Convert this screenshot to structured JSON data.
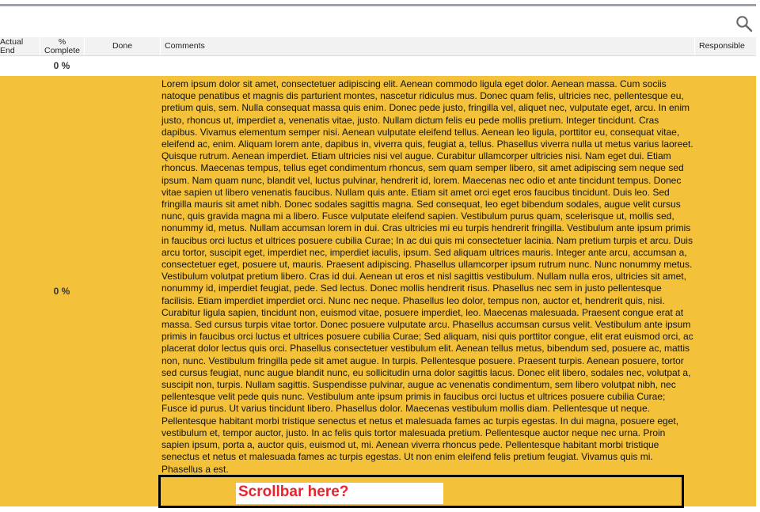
{
  "columns": {
    "actual_end": "Actual\nEnd",
    "pct_complete": "%\nComplete",
    "done": "Done",
    "comments": "Comments",
    "responsible": "Responsible"
  },
  "rows": [
    {
      "pct_complete": "0 %",
      "comment": ""
    },
    {
      "pct_complete": "0 %",
      "comment": "Lorem ipsum dolor sit amet, consectetuer adipiscing elit. Aenean commodo ligula eget dolor. Aenean massa. Cum sociis natoque penatibus et magnis dis parturient montes, nascetur ridiculus mus. Donec quam felis, ultricies nec, pellentesque eu, pretium quis, sem. Nulla consequat massa quis enim. Donec pede justo, fringilla vel, aliquet nec, vulputate eget, arcu. In enim justo, rhoncus ut, imperdiet a, venenatis vitae, justo. Nullam dictum felis eu pede mollis pretium. Integer tincidunt. Cras dapibus. Vivamus elementum semper nisi. Aenean vulputate eleifend tellus. Aenean leo ligula, porttitor eu, consequat vitae, eleifend ac, enim. Aliquam lorem ante, dapibus in, viverra quis, feugiat a, tellus. Phasellus viverra nulla ut metus varius laoreet. Quisque rutrum. Aenean imperdiet. Etiam ultricies nisi vel augue. Curabitur ullamcorper ultricies nisi. Nam eget dui. Etiam rhoncus. Maecenas tempus, tellus eget condimentum rhoncus, sem quam semper libero, sit amet adipiscing sem neque sed ipsum. Nam quam nunc, blandit vel, luctus pulvinar, hendrerit id, lorem. Maecenas nec odio et ante tincidunt tempus. Donec vitae sapien ut libero venenatis faucibus. Nullam quis ante. Etiam sit amet orci eget eros faucibus tincidunt. Duis leo. Sed fringilla mauris sit amet nibh. Donec sodales sagittis magna. Sed consequat, leo eget bibendum sodales, augue velit cursus nunc, quis gravida magna mi a libero. Fusce vulputate eleifend sapien. Vestibulum purus quam, scelerisque ut, mollis sed, nonummy id, metus. Nullam accumsan lorem in dui. Cras ultricies mi eu turpis hendrerit fringilla. Vestibulum ante ipsum primis in faucibus orci luctus et ultrices posuere cubilia Curae; In ac dui quis mi consectetuer lacinia. Nam pretium turpis et arcu. Duis arcu tortor, suscipit eget, imperdiet nec, imperdiet iaculis, ipsum. Sed aliquam ultrices mauris. Integer ante arcu, accumsan a, consectetuer eget, posuere ut, mauris. Praesent adipiscing. Phasellus ullamcorper ipsum rutrum nunc. Nunc nonummy metus. Vestibulum volutpat pretium libero. Cras id dui. Aenean ut eros et nisl sagittis vestibulum. Nullam nulla eros, ultricies sit amet, nonummy id, imperdiet feugiat, pede. Sed lectus. Donec mollis hendrerit risus. Phasellus nec sem in justo pellentesque facilisis. Etiam imperdiet imperdiet orci. Nunc nec neque. Phasellus leo dolor, tempus non, auctor et, hendrerit quis, nisi. Curabitur ligula sapien, tincidunt non, euismod vitae, posuere imperdiet, leo. Maecenas malesuada. Praesent congue erat at massa. Sed cursus turpis vitae tortor. Donec posuere vulputate arcu. Phasellus accumsan cursus velit. Vestibulum ante ipsum primis in faucibus orci luctus et ultrices posuere cubilia Curae; Sed aliquam, nisi quis porttitor congue, elit erat euismod orci, ac placerat dolor lectus quis orci. Phasellus consectetuer vestibulum elit. Aenean tellus metus, bibendum sed, posuere ac, mattis non, nunc. Vestibulum fringilla pede sit amet augue. In turpis. Pellentesque posuere. Praesent turpis. Aenean posuere, tortor sed cursus feugiat, nunc augue blandit nunc, eu sollicitudin urna dolor sagittis lacus. Donec elit libero, sodales nec, volutpat a, suscipit non, turpis. Nullam sagittis. Suspendisse pulvinar, augue ac venenatis condimentum, sem libero volutpat nibh, nec pellentesque velit pede quis nunc. Vestibulum ante ipsum primis in faucibus orci luctus et ultrices posuere cubilia Curae; Fusce id purus. Ut varius tincidunt libero. Phasellus dolor. Maecenas vestibulum mollis diam. Pellentesque ut neque. Pellentesque habitant morbi tristique senectus et netus et malesuada fames ac turpis egestas. In dui magna, posuere eget, vestibulum et, tempor auctor, justo. In ac felis quis tortor malesuada pretium. Pellentesque auctor neque nec urna. Proin sapien ipsum, porta a, auctor quis, euismod ut, mi. Aenean viverra rhoncus pede. Pellentesque habitant morbi tristique senectus et netus et malesuada fames ac turpis egestas. Ut non enim eleifend felis pretium feugiat. Vivamus quis mi. Phasellus a est."
    }
  ],
  "annotation": {
    "callout_text": "Scrollbar here?"
  },
  "icons": {
    "search": "search-icon"
  },
  "colors": {
    "row_highlight": "#f3c13a",
    "callout_text": "#e8242c",
    "header_bg": "#f2f2f2"
  }
}
